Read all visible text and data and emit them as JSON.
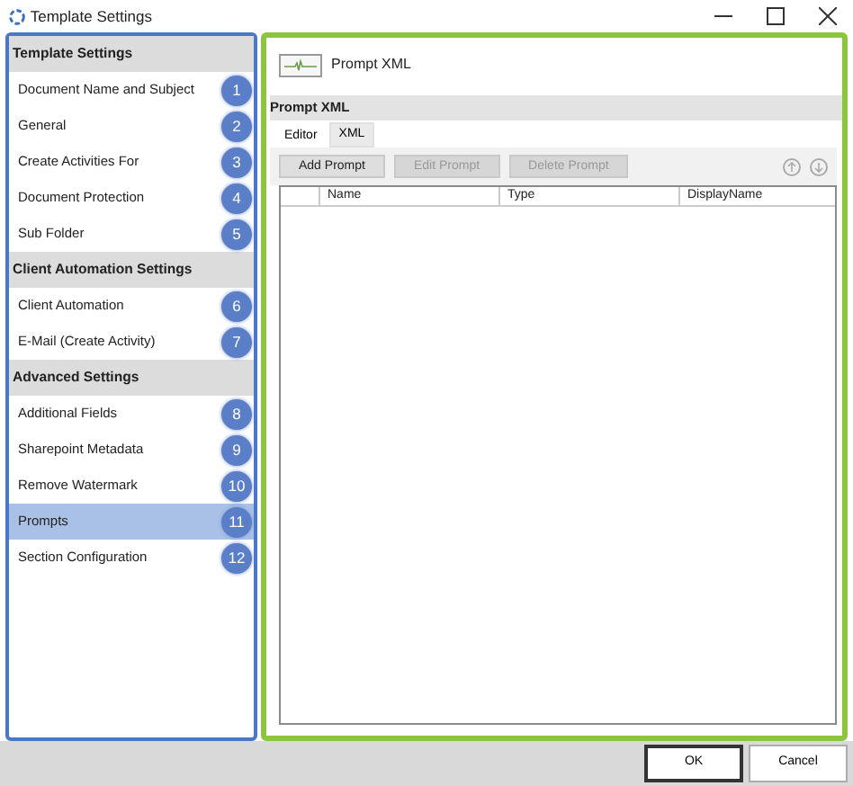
{
  "window": {
    "title": "Template Settings"
  },
  "sidebar": {
    "sections": [
      {
        "heading": "Template Settings",
        "items": [
          {
            "label": "Document Name and Subject",
            "number": "1",
            "selected": false
          },
          {
            "label": "General",
            "number": "2",
            "selected": false
          },
          {
            "label": "Create Activities For",
            "number": "3",
            "selected": false
          },
          {
            "label": "Document Protection",
            "number": "4",
            "selected": false
          },
          {
            "label": "Sub Folder",
            "number": "5",
            "selected": false
          }
        ]
      },
      {
        "heading": "Client Automation Settings",
        "items": [
          {
            "label": "Client Automation",
            "number": "6",
            "selected": false
          },
          {
            "label": "E-Mail (Create Activity)",
            "number": "7",
            "selected": false
          }
        ]
      },
      {
        "heading": "Advanced Settings",
        "items": [
          {
            "label": "Additional Fields",
            "number": "8",
            "selected": false
          },
          {
            "label": "Sharepoint Metadata",
            "number": "9",
            "selected": false
          },
          {
            "label": "Remove Watermark",
            "number": "10",
            "selected": false
          },
          {
            "label": "Prompts",
            "number": "11",
            "selected": true
          },
          {
            "label": "Section Configuration",
            "number": "12",
            "selected": false
          }
        ]
      }
    ]
  },
  "panel": {
    "title": "Prompt XML",
    "section": "Prompt XML",
    "tabs": [
      {
        "label": "Editor",
        "selected": true
      },
      {
        "label": "XML",
        "selected": false
      }
    ],
    "buttons": [
      {
        "label": "Add Prompt",
        "disabled": false
      },
      {
        "label": "Edit Prompt",
        "disabled": true
      },
      {
        "label": "Delete Prompt",
        "disabled": true
      }
    ],
    "table": {
      "columns": [
        "Name",
        "Type",
        "DisplayName"
      ]
    }
  },
  "footer": {
    "buttons": [
      {
        "label": "OK",
        "default": true
      },
      {
        "label": "Cancel",
        "default": false
      }
    ]
  }
}
